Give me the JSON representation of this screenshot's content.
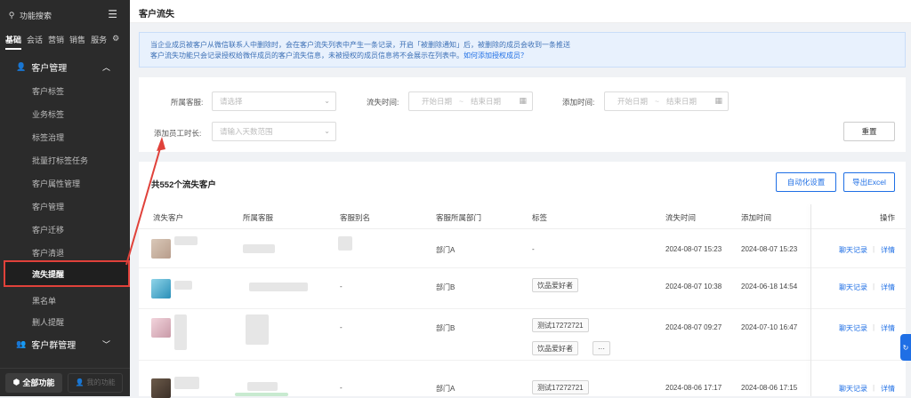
{
  "sidebar": {
    "search_label": "功能搜索",
    "tabs": [
      "基础",
      "会话",
      "营销",
      "销售",
      "服务"
    ],
    "group": "客户管理",
    "items": [
      "客户标签",
      "业务标签",
      "标签治理",
      "批量打标签任务",
      "客户属性管理",
      "客户管理",
      "客户迁移",
      "客户清退",
      "流失提醒",
      "黑名单",
      "删人提醒"
    ],
    "group2": "客户群管理",
    "btn_all": "全部功能",
    "btn_mine": "我的功能"
  },
  "topbar": {
    "title": "客户流失"
  },
  "notice": {
    "line1": "当企业成员被客户从微信联系人中删除时，会在客户流失列表中产生一条记录，开启「被删除通知」后，被删除的成员会收到一条推送",
    "line2": "客户流失功能只会记录授权给微伴成员的客户流失信息，未被授权的成员信息将不会展示在列表中。",
    "link": "如何添加授权成员？"
  },
  "filter": {
    "owner_label": "所属客服:",
    "owner_placeholder": "请选择",
    "lost_label": "流失时间:",
    "added_label": "添加时间:",
    "start_date": "开始日期",
    "end_date": "结束日期",
    "date_sep": "~",
    "duration_label": "添加员工时长:",
    "duration_placeholder": "请输入天数范围",
    "reset": "重置"
  },
  "list": {
    "title": "共552个流失客户",
    "btn_auto": "自动化设置",
    "btn_export": "导出Excel",
    "columns": [
      "流失客户",
      "所属客服",
      "客服别名",
      "客服所属部门",
      "标签",
      "流失时间",
      "添加时间",
      "操作"
    ],
    "op_chat": "聊天记录",
    "op_detail": "详情",
    "rows": [
      {
        "alias": "",
        "dept": "部门A",
        "tags": [
          "-"
        ],
        "lost": "2024-08-07 15:23",
        "added": "2024-08-07 15:23"
      },
      {
        "alias": "-",
        "dept": "部门B",
        "tags": [
          "饮品爱好者"
        ],
        "lost": "2024-08-07 10:38",
        "added": "2024-06-18 14:54"
      },
      {
        "alias": "-",
        "dept": "部门B",
        "tags": [
          "测试17272721",
          "饮品爱好者",
          "···"
        ],
        "lost": "2024-08-07 09:27",
        "added": "2024-07-10 16:47"
      },
      {
        "alias": "-",
        "dept": "部门A",
        "tags": [
          "测试17272721"
        ],
        "lost": "2024-08-06 17:17",
        "added": "2024-08-06 17:15"
      }
    ]
  },
  "colors": {
    "accent": "#1f6fe5",
    "highlight": "#e0413a",
    "sidebar": "#2b2b2b"
  }
}
